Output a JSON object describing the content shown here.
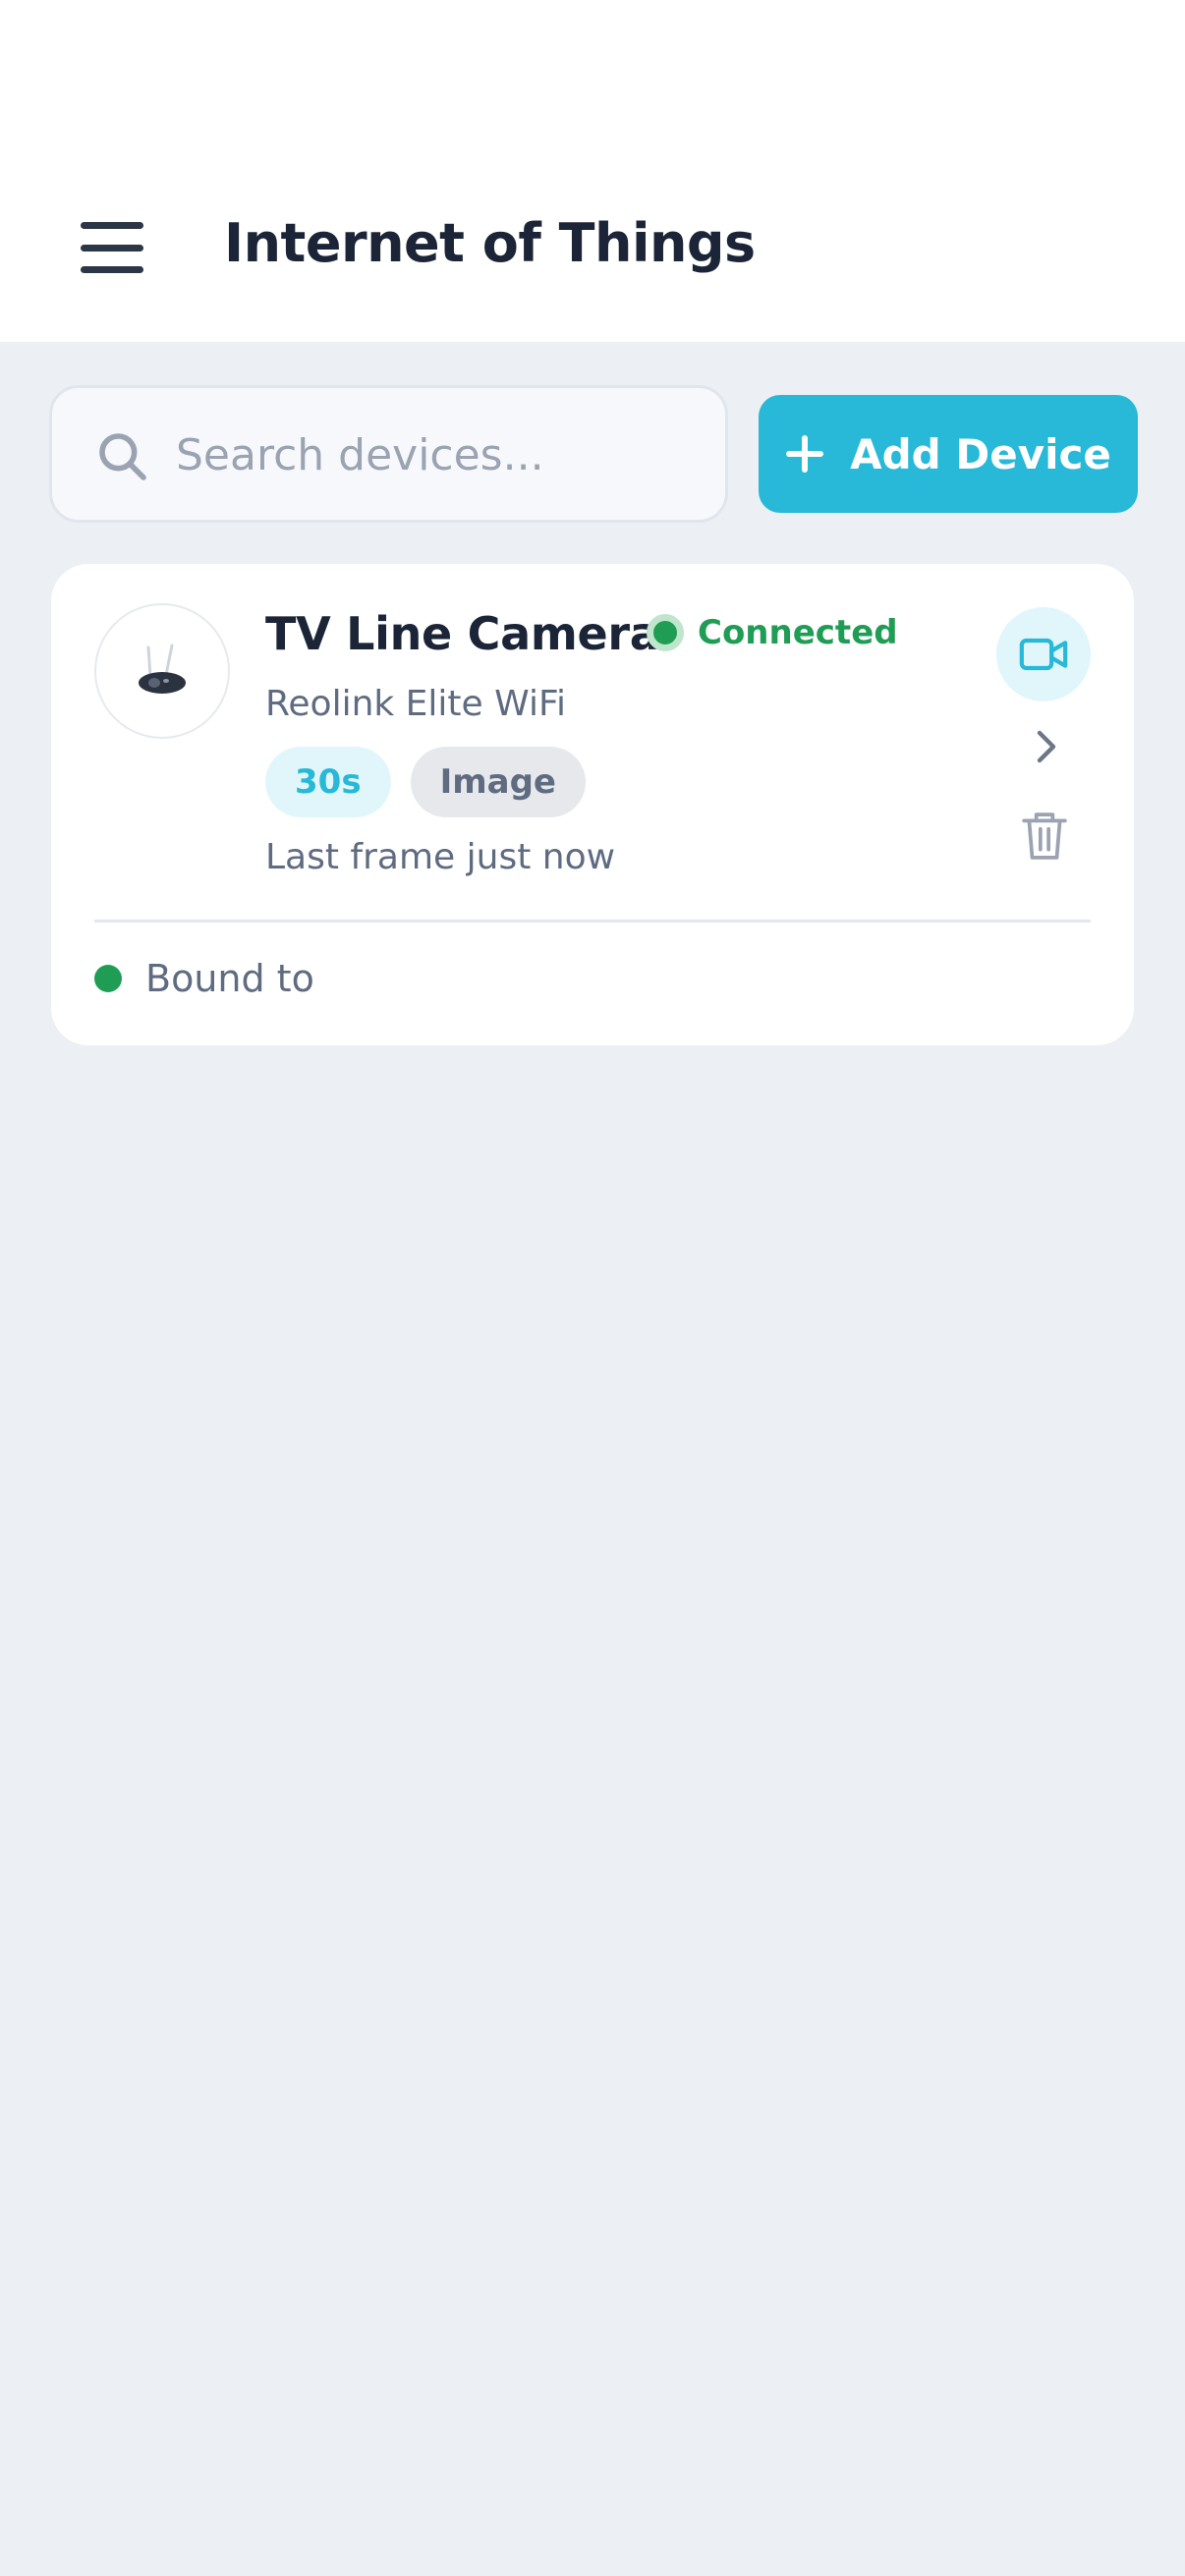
{
  "header": {
    "title": "Internet of Things",
    "menu_icon": "hamburger-menu-icon"
  },
  "search": {
    "placeholder": "Search devices...",
    "value": "",
    "icon": "search-icon"
  },
  "add_device": {
    "label": "Add Device",
    "icon": "plus-icon"
  },
  "devices": [
    {
      "name": "TV Line Camera",
      "status": "Connected",
      "model": "Reolink Elite WiFi",
      "tags": [
        "30s",
        "Image"
      ],
      "last_frame": "Last frame just now",
      "binding": "Bound to",
      "actions": [
        "video-camera-icon",
        "chevron-right-icon",
        "trash-icon"
      ]
    }
  ],
  "colors": {
    "accent": "#27b9d7",
    "status_green": "#1f9d55",
    "background": "#eceff4",
    "text_primary": "#1b2537",
    "text_secondary": "#5f6b80"
  }
}
